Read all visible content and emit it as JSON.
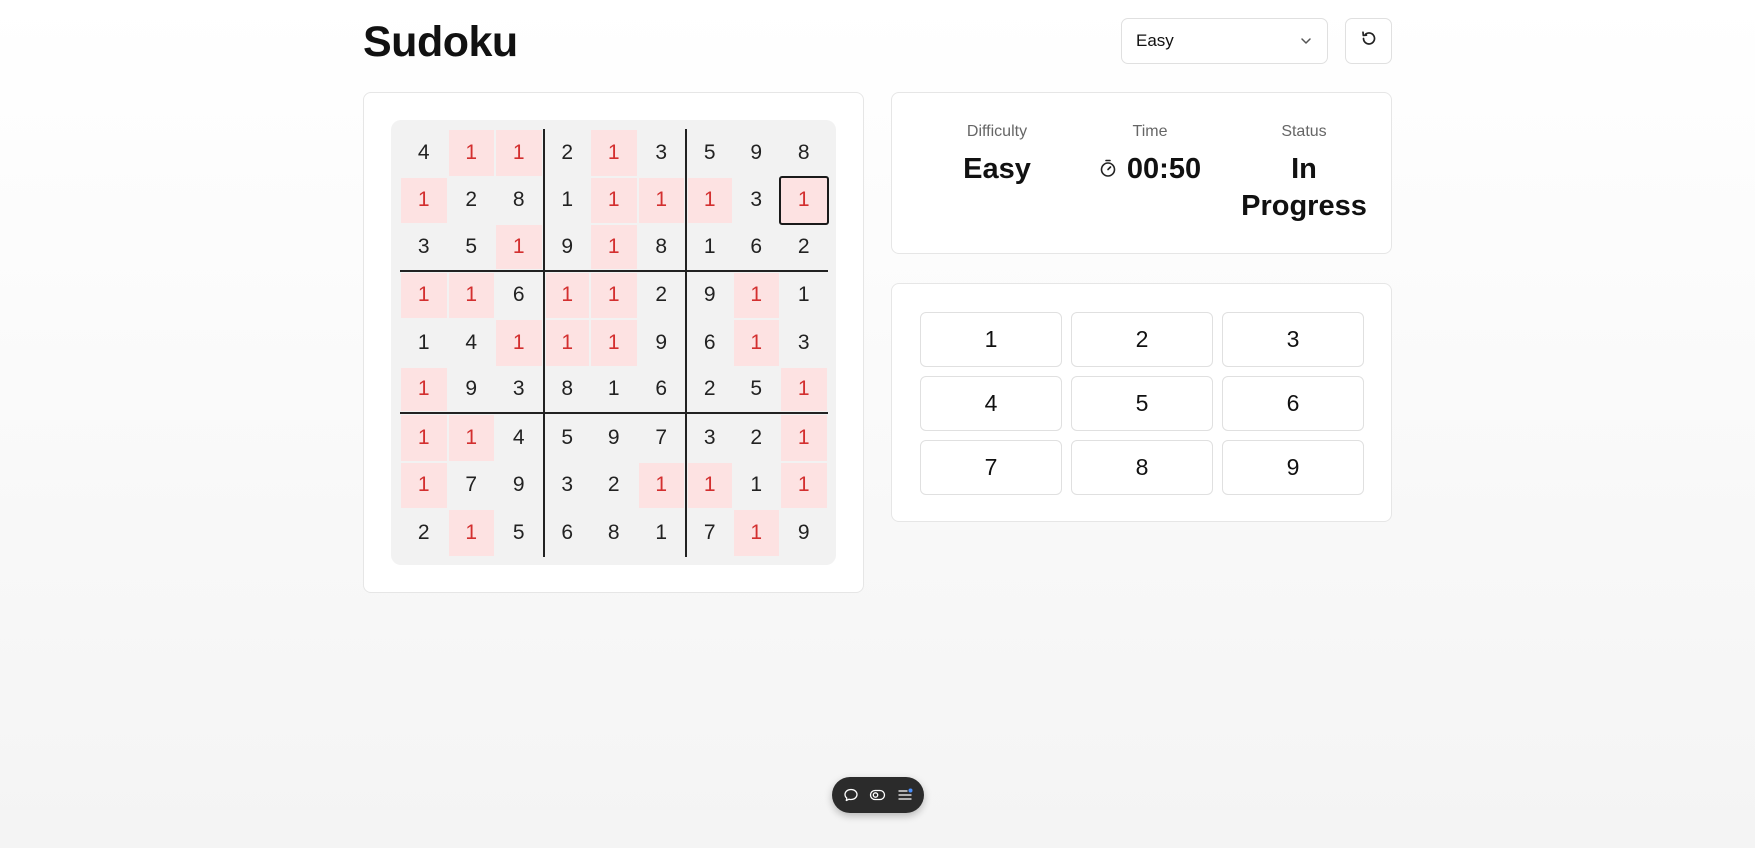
{
  "header": {
    "title": "Sudoku",
    "difficulty_select": "Easy",
    "chevron_icon": "chevron-down-icon",
    "reset_icon": "refresh-icon"
  },
  "board": {
    "rows": [
      [
        "4",
        "1",
        "1",
        "2",
        "1",
        "3",
        "5",
        "9",
        "8"
      ],
      [
        "1",
        "2",
        "8",
        "1",
        "1",
        "1",
        "1",
        "3",
        "1"
      ],
      [
        "3",
        "5",
        "1",
        "9",
        "1",
        "8",
        "1",
        "6",
        "2"
      ],
      [
        "1",
        "1",
        "6",
        "1",
        "1",
        "2",
        "9",
        "1",
        "1"
      ],
      [
        "1",
        "4",
        "1",
        "1",
        "1",
        "9",
        "6",
        "1",
        "3"
      ],
      [
        "1",
        "9",
        "3",
        "8",
        "1",
        "6",
        "2",
        "5",
        "1"
      ],
      [
        "1",
        "1",
        "4",
        "5",
        "9",
        "7",
        "3",
        "2",
        "1"
      ],
      [
        "1",
        "7",
        "9",
        "3",
        "2",
        "1",
        "1",
        "1",
        "1"
      ],
      [
        "2",
        "1",
        "5",
        "6",
        "8",
        "1",
        "7",
        "1",
        "9"
      ]
    ],
    "conflicts": [
      [
        0,
        1
      ],
      [
        0,
        2
      ],
      [
        0,
        4
      ],
      [
        1,
        0
      ],
      [
        1,
        4
      ],
      [
        1,
        5
      ],
      [
        1,
        6
      ],
      [
        1,
        8
      ],
      [
        2,
        2
      ],
      [
        2,
        4
      ],
      [
        3,
        0
      ],
      [
        3,
        1
      ],
      [
        3,
        3
      ],
      [
        3,
        4
      ],
      [
        3,
        7
      ],
      [
        4,
        2
      ],
      [
        4,
        3
      ],
      [
        4,
        4
      ],
      [
        4,
        7
      ],
      [
        5,
        0
      ],
      [
        5,
        8
      ],
      [
        6,
        0
      ],
      [
        6,
        1
      ],
      [
        6,
        8
      ],
      [
        7,
        0
      ],
      [
        7,
        5
      ],
      [
        7,
        6
      ],
      [
        7,
        8
      ],
      [
        8,
        1
      ],
      [
        8,
        7
      ]
    ],
    "selected": [
      1,
      8
    ],
    "conflict_bg_color": "#fde2e2",
    "conflict_text_color": "#d32f2f"
  },
  "stats": {
    "difficulty_label": "Difficulty",
    "difficulty_value": "Easy",
    "time_label": "Time",
    "time_value": "00:50",
    "time_icon": "stopwatch-icon",
    "status_label": "Status",
    "status_value": "In Progress"
  },
  "numpad": [
    "1",
    "2",
    "3",
    "4",
    "5",
    "6",
    "7",
    "8",
    "9"
  ],
  "toolbar": {
    "icons": [
      "chat-icon",
      "toggle-icon",
      "menu-icon"
    ]
  }
}
